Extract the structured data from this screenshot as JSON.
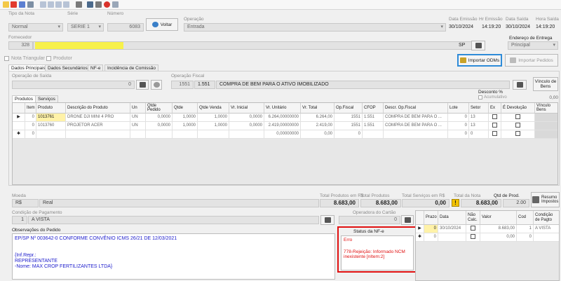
{
  "toolbar": {
    "icons": [
      "new-icon",
      "delete-icon",
      "save-icon",
      "undo-icon",
      "first-icon",
      "prev-icon",
      "next-icon",
      "last-icon",
      "print-icon",
      "email-icon",
      "lock-icon",
      "cancel-icon",
      "copy-icon"
    ]
  },
  "header": {
    "tipo_label": "Tipo da Nota",
    "tipo_value": "Normal",
    "serie_label": "Série",
    "serie_value": "SERIE 1",
    "numero_label": "Número",
    "numero_value": "6083",
    "voltar_label": "Voltar",
    "operacao_label": "Operação",
    "operacao_value": "Entrada",
    "data_emissao_label": "Data Emissão",
    "data_emissao_value": "30/10/2024",
    "hr_emissao_label": "Hr Emissão",
    "hr_emissao_value": "14:19:20",
    "data_saida_label": "Data Saída",
    "data_saida_value": "30/10/2024",
    "hora_saida_label": "Hora Saída",
    "hora_saida_value": "14:19:20"
  },
  "fornecedor": {
    "label": "Fornecedor",
    "code": "328",
    "uf": "SP",
    "endereco_label": "Endereço de Entrega",
    "endereco_value": "Principal"
  },
  "checks": {
    "nota_triangular": "Nota Triangular",
    "produtor": "Produtor"
  },
  "actions": {
    "importar_odms": "Importar ODMs",
    "importar_pedidos": "Importar Pedidos"
  },
  "main_tabs": [
    "Dados Principais",
    "Dados Secundários",
    "NF-e",
    "Incidência de Comissão"
  ],
  "operacao_saida": {
    "label": "Operação de Saída",
    "value": "0"
  },
  "operacao_fiscal": {
    "label": "Operação Fiscal",
    "code1": "1551",
    "code2": "1.551",
    "desc": "COMPRA DE BEM PARA O ATIVO IMOBILIZADO"
  },
  "vinculo_bens": "Vínculo de Bens",
  "sub_tabs": [
    "Produtos",
    "Serviços"
  ],
  "desconto": {
    "label": "Desconto %",
    "acumulativo": "Acumulativo",
    "value": "0,00"
  },
  "products": {
    "headers": [
      "Item",
      "Produto",
      "Descrição do Produto",
      "Un",
      "Qtde Pedido",
      "Qtde",
      "Qtde Venda",
      "Vr. Inicial",
      "Vr. Unitário",
      "Vr. Total",
      "Op.Fiscal",
      "CFOP",
      "Descr. Op.Fiscal",
      "Lote",
      "Setor",
      "Ex",
      "É Devolução",
      "Vínculo Bens"
    ],
    "rows": [
      {
        "marker": "▶",
        "item": "0",
        "produto": "1013761",
        "desc": "DRONE DJI MINI 4 PRO",
        "un": "UN",
        "qped": "0,0000",
        "qtde": "1,0000",
        "qvenda": "1,0000",
        "vinicial": "0,0000",
        "vunit": "6.264,00000000",
        "vtotal": "6.264,00",
        "opf": "1551",
        "cfop": "1.551",
        "dopf": "COMPRA DE BEM PARA O ...",
        "lote": "0",
        "setor": "13"
      },
      {
        "marker": "",
        "item": "0",
        "produto": "1013760",
        "desc": "PROJETOR ACER",
        "un": "UN",
        "qped": "0,0000",
        "qtde": "1,0000",
        "qvenda": "1,0000",
        "vinicial": "0,0000",
        "vunit": "2.419,00000000",
        "vtotal": "2.419,00",
        "opf": "1551",
        "cfop": "1.551",
        "dopf": "COMPRA DE BEM PARA O ...",
        "lote": "0",
        "setor": "13"
      },
      {
        "marker": "✱",
        "item": "0",
        "produto": "",
        "desc": "",
        "un": "",
        "qped": "",
        "qtde": "",
        "qvenda": "",
        "vinicial": "",
        "vunit": "0,00000000",
        "vtotal": "0,00",
        "opf": "0",
        "cfop": "",
        "dopf": "",
        "lote": "0",
        "setor": "0"
      }
    ]
  },
  "moeda": {
    "label": "Moeda",
    "code": "R$",
    "name": "Real"
  },
  "totals": {
    "tp_rs_label": "Total Produtos em R$",
    "tp_rs_value": "8.683,00",
    "tp_label": "Total Produtos",
    "tp_value": "8.683,00",
    "ts_rs_label": "Total Serviços em R$",
    "ts_rs_value": "0,00",
    "tn_label": "Total da Nota",
    "tn_value": "8.683,00",
    "qtd_label": "Qtd de Prod.",
    "qtd_value": "2.00",
    "resumo_label": "Resumo Impostos"
  },
  "pagamento": {
    "label": "Condição de Pagamento",
    "code": "1",
    "value": "A VISTA"
  },
  "cartao": {
    "label": "Operadora do Cartão",
    "value": "0"
  },
  "observacoes": {
    "label": "Observações do Pedido",
    "lines": [
      "EP/SP Nº 003642-0 CONFORME CONVÊNIO ICMS 26/21 DE 12/03/2021",
      "",
      "{Inf.Repr.:",
      "REPRESENTANTE",
      "-Nome: MAX CROP FERTILIZANTES LTDA}"
    ]
  },
  "status_nfe": {
    "label": "Status da NF-e",
    "status": "Erro",
    "message": "778-Rejeição: Informado NCM inexistente [nItem:2]"
  },
  "parcelas": {
    "headers": [
      "Prazo",
      "Data",
      "Não Calc.",
      "Valor",
      "Cod",
      "Condição de Pagto"
    ],
    "rows": [
      {
        "marker": "▶",
        "prazo": "0",
        "data": "30/10/2024",
        "valor": "8.683,00",
        "cod": "1",
        "cond": "A VISTA"
      },
      {
        "marker": "✱",
        "prazo": "0",
        "data": "",
        "valor": "0,00",
        "cod": "0",
        "cond": ""
      }
    ]
  },
  "colors": {
    "accent": "#2e8bd8",
    "error": "#e01010",
    "link_blue": "#1c1ccc",
    "highlight": "#fff2a8"
  }
}
